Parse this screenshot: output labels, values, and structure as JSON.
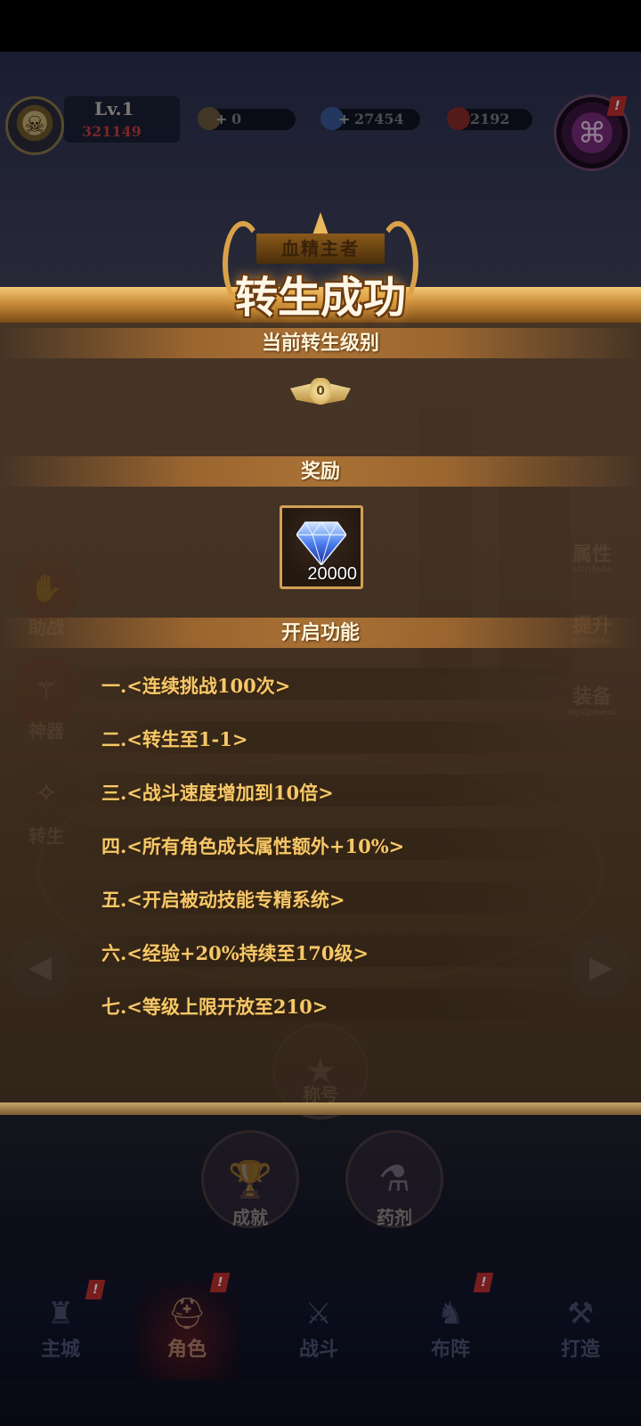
{
  "hud": {
    "level": "Lv.1",
    "power": "321149",
    "resources": [
      {
        "icon": "scroll-coin-icon",
        "value": "0"
      },
      {
        "icon": "diamond-icon",
        "value": "27454"
      },
      {
        "icon": "ruby-icon",
        "value": "2192"
      }
    ],
    "scroll_badge": "!"
  },
  "left_menu": [
    {
      "label": "助战",
      "icon": "assist-icon"
    },
    {
      "label": "神器",
      "icon": "artifact-icon"
    },
    {
      "label": "转生",
      "icon": "rebirth-icon"
    }
  ],
  "right_tabs": [
    {
      "label": "属性",
      "sub": "attribute"
    },
    {
      "label": "提升",
      "sub": "promote"
    },
    {
      "label": "装备",
      "sub": "equipment"
    }
  ],
  "bottom_menu": {
    "title_button": "称号",
    "buttons": [
      {
        "label": "成就",
        "icon": "trophy-icon"
      },
      {
        "label": "药剂",
        "icon": "potion-icon"
      }
    ]
  },
  "nav": [
    {
      "label": "主城",
      "icon": "castle-icon",
      "badge": "!"
    },
    {
      "label": "角色",
      "icon": "helmet-icon",
      "badge": "!",
      "active": true
    },
    {
      "label": "战斗",
      "icon": "crossed-swords-icon"
    },
    {
      "label": "布阵",
      "icon": "formation-icon",
      "badge": "!"
    },
    {
      "label": "打造",
      "icon": "anvil-icon"
    }
  ],
  "dialog": {
    "crest_text": "血精主者",
    "title": "转生成功",
    "rank_section": "当前转生级别",
    "rank_value": "0",
    "reward_section": "奖励",
    "reward": {
      "icon": "diamond-icon",
      "count": "20000"
    },
    "unlock_section": "开启功能",
    "unlocks": [
      "一.<连续挑战100次>",
      "二.<转生至1-1>",
      "三.<战斗速度增加到10倍>",
      "四.<所有角色成长属性额外+10%>",
      "五.<开启被动技能专精系统>",
      "六.<经验+20%持续至170级>",
      "七.<等级上限开放至210>"
    ]
  },
  "colors": {
    "gold_text": "#f6c86a",
    "title_bar": "#c98c3a",
    "reward_border": "#d3a056"
  }
}
